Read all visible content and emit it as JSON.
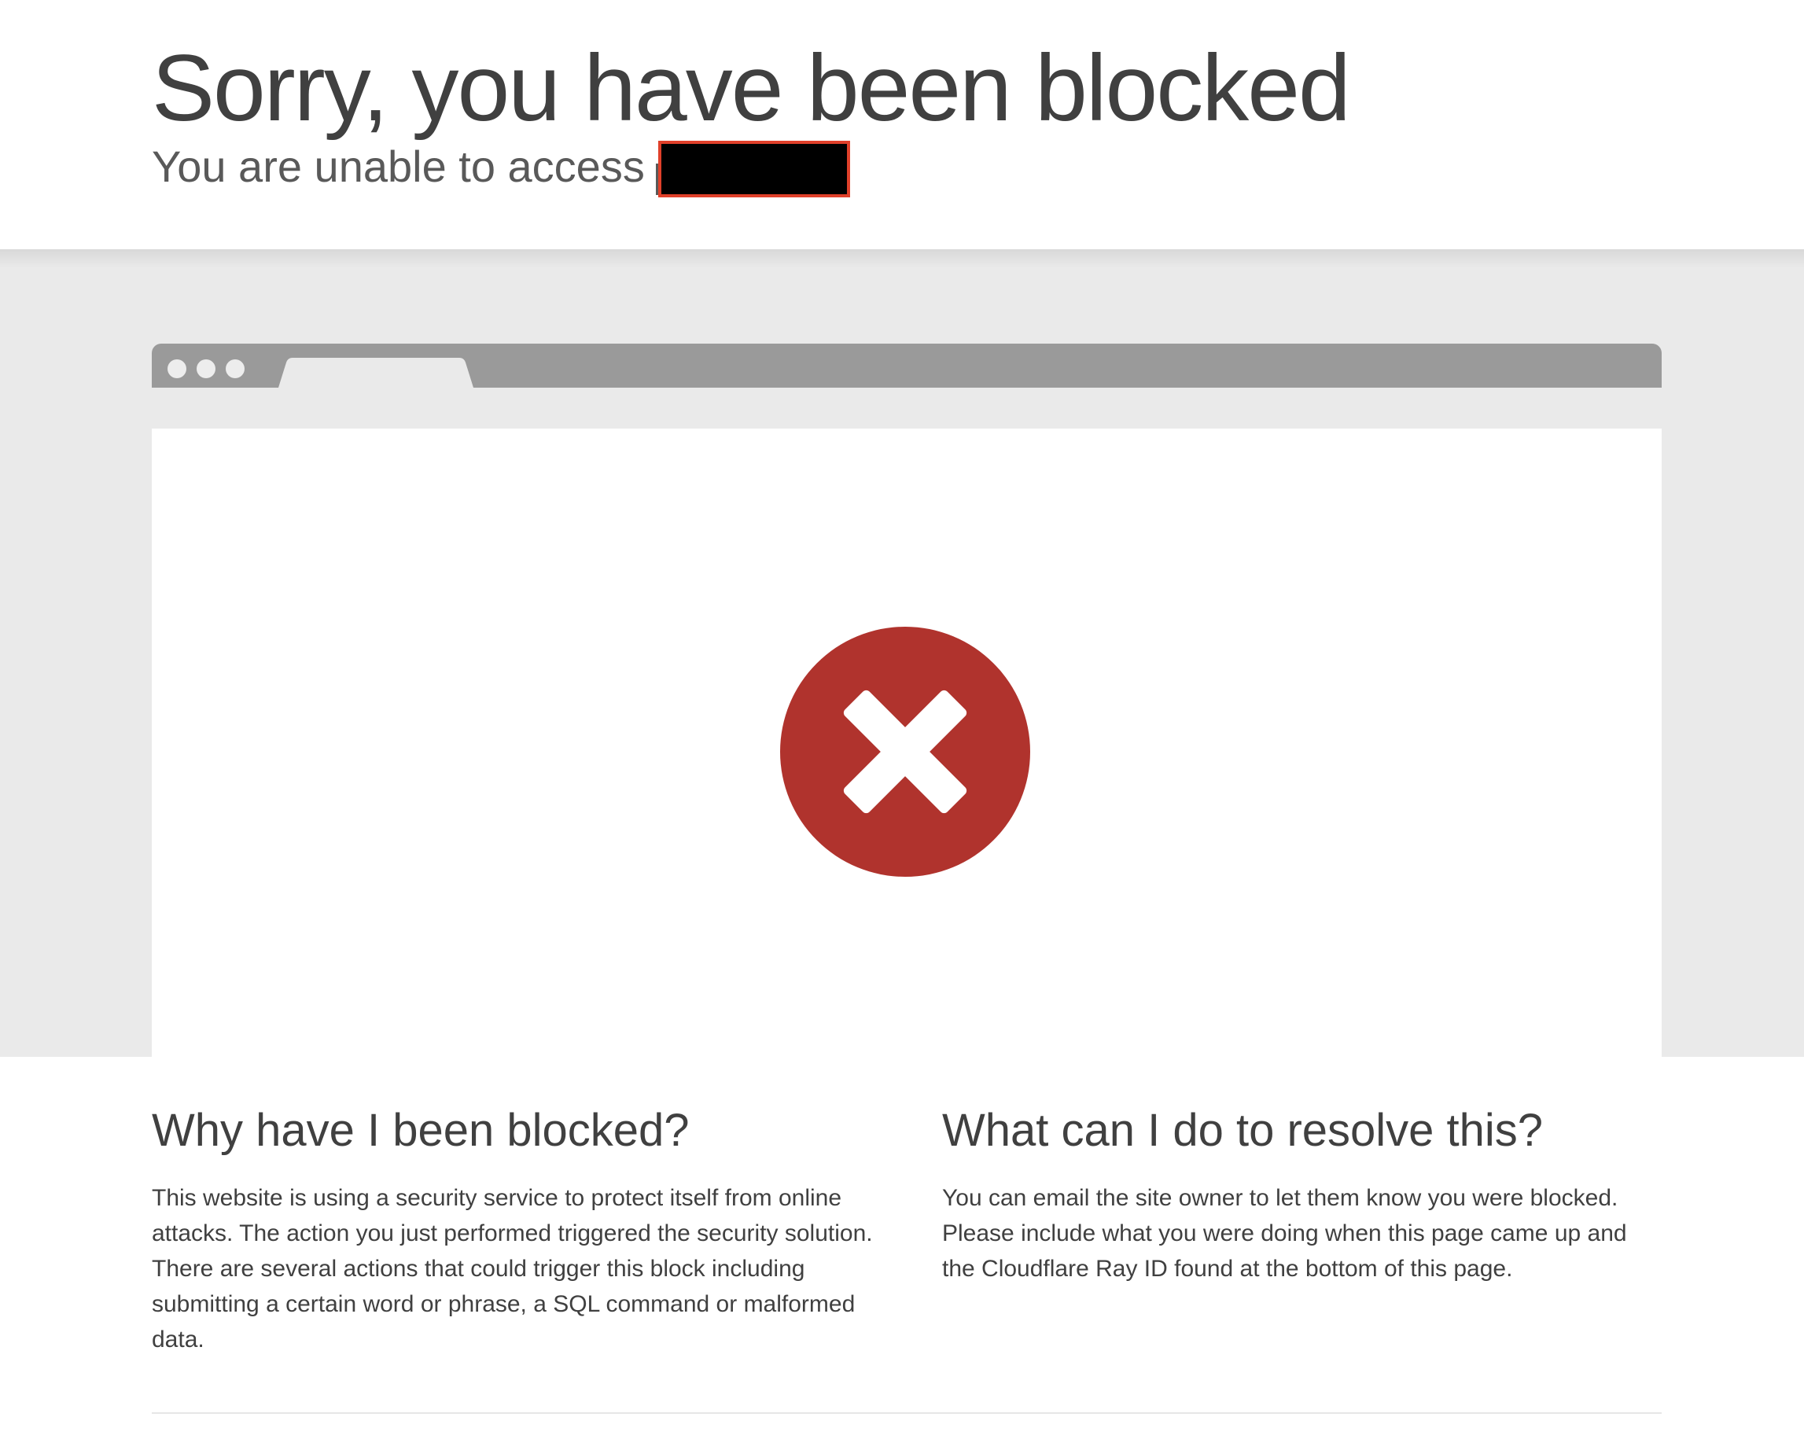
{
  "header": {
    "title": "Sorry, you have been blocked",
    "subtitle": "You are unable to access"
  },
  "colors": {
    "error_red": "#b0332d",
    "band_gray": "#eaeaea",
    "browser_bar": "#9a9a9a",
    "redaction_border": "#e0402a"
  },
  "illustration": {
    "icon": "error-x-circle-icon"
  },
  "why_blocked": {
    "heading": "Why have I been blocked?",
    "body": "This website is using a security service to protect itself from online attacks. The action you just performed triggered the security solution. There are several actions that could trigger this block including submitting a certain word or phrase, a SQL command or malformed data."
  },
  "resolve": {
    "heading": "What can I do to resolve this?",
    "body": "You can email the site owner to let them know you were blocked. Please include what you were doing when this page came up and the Cloudflare Ray ID found at the bottom of this page."
  }
}
